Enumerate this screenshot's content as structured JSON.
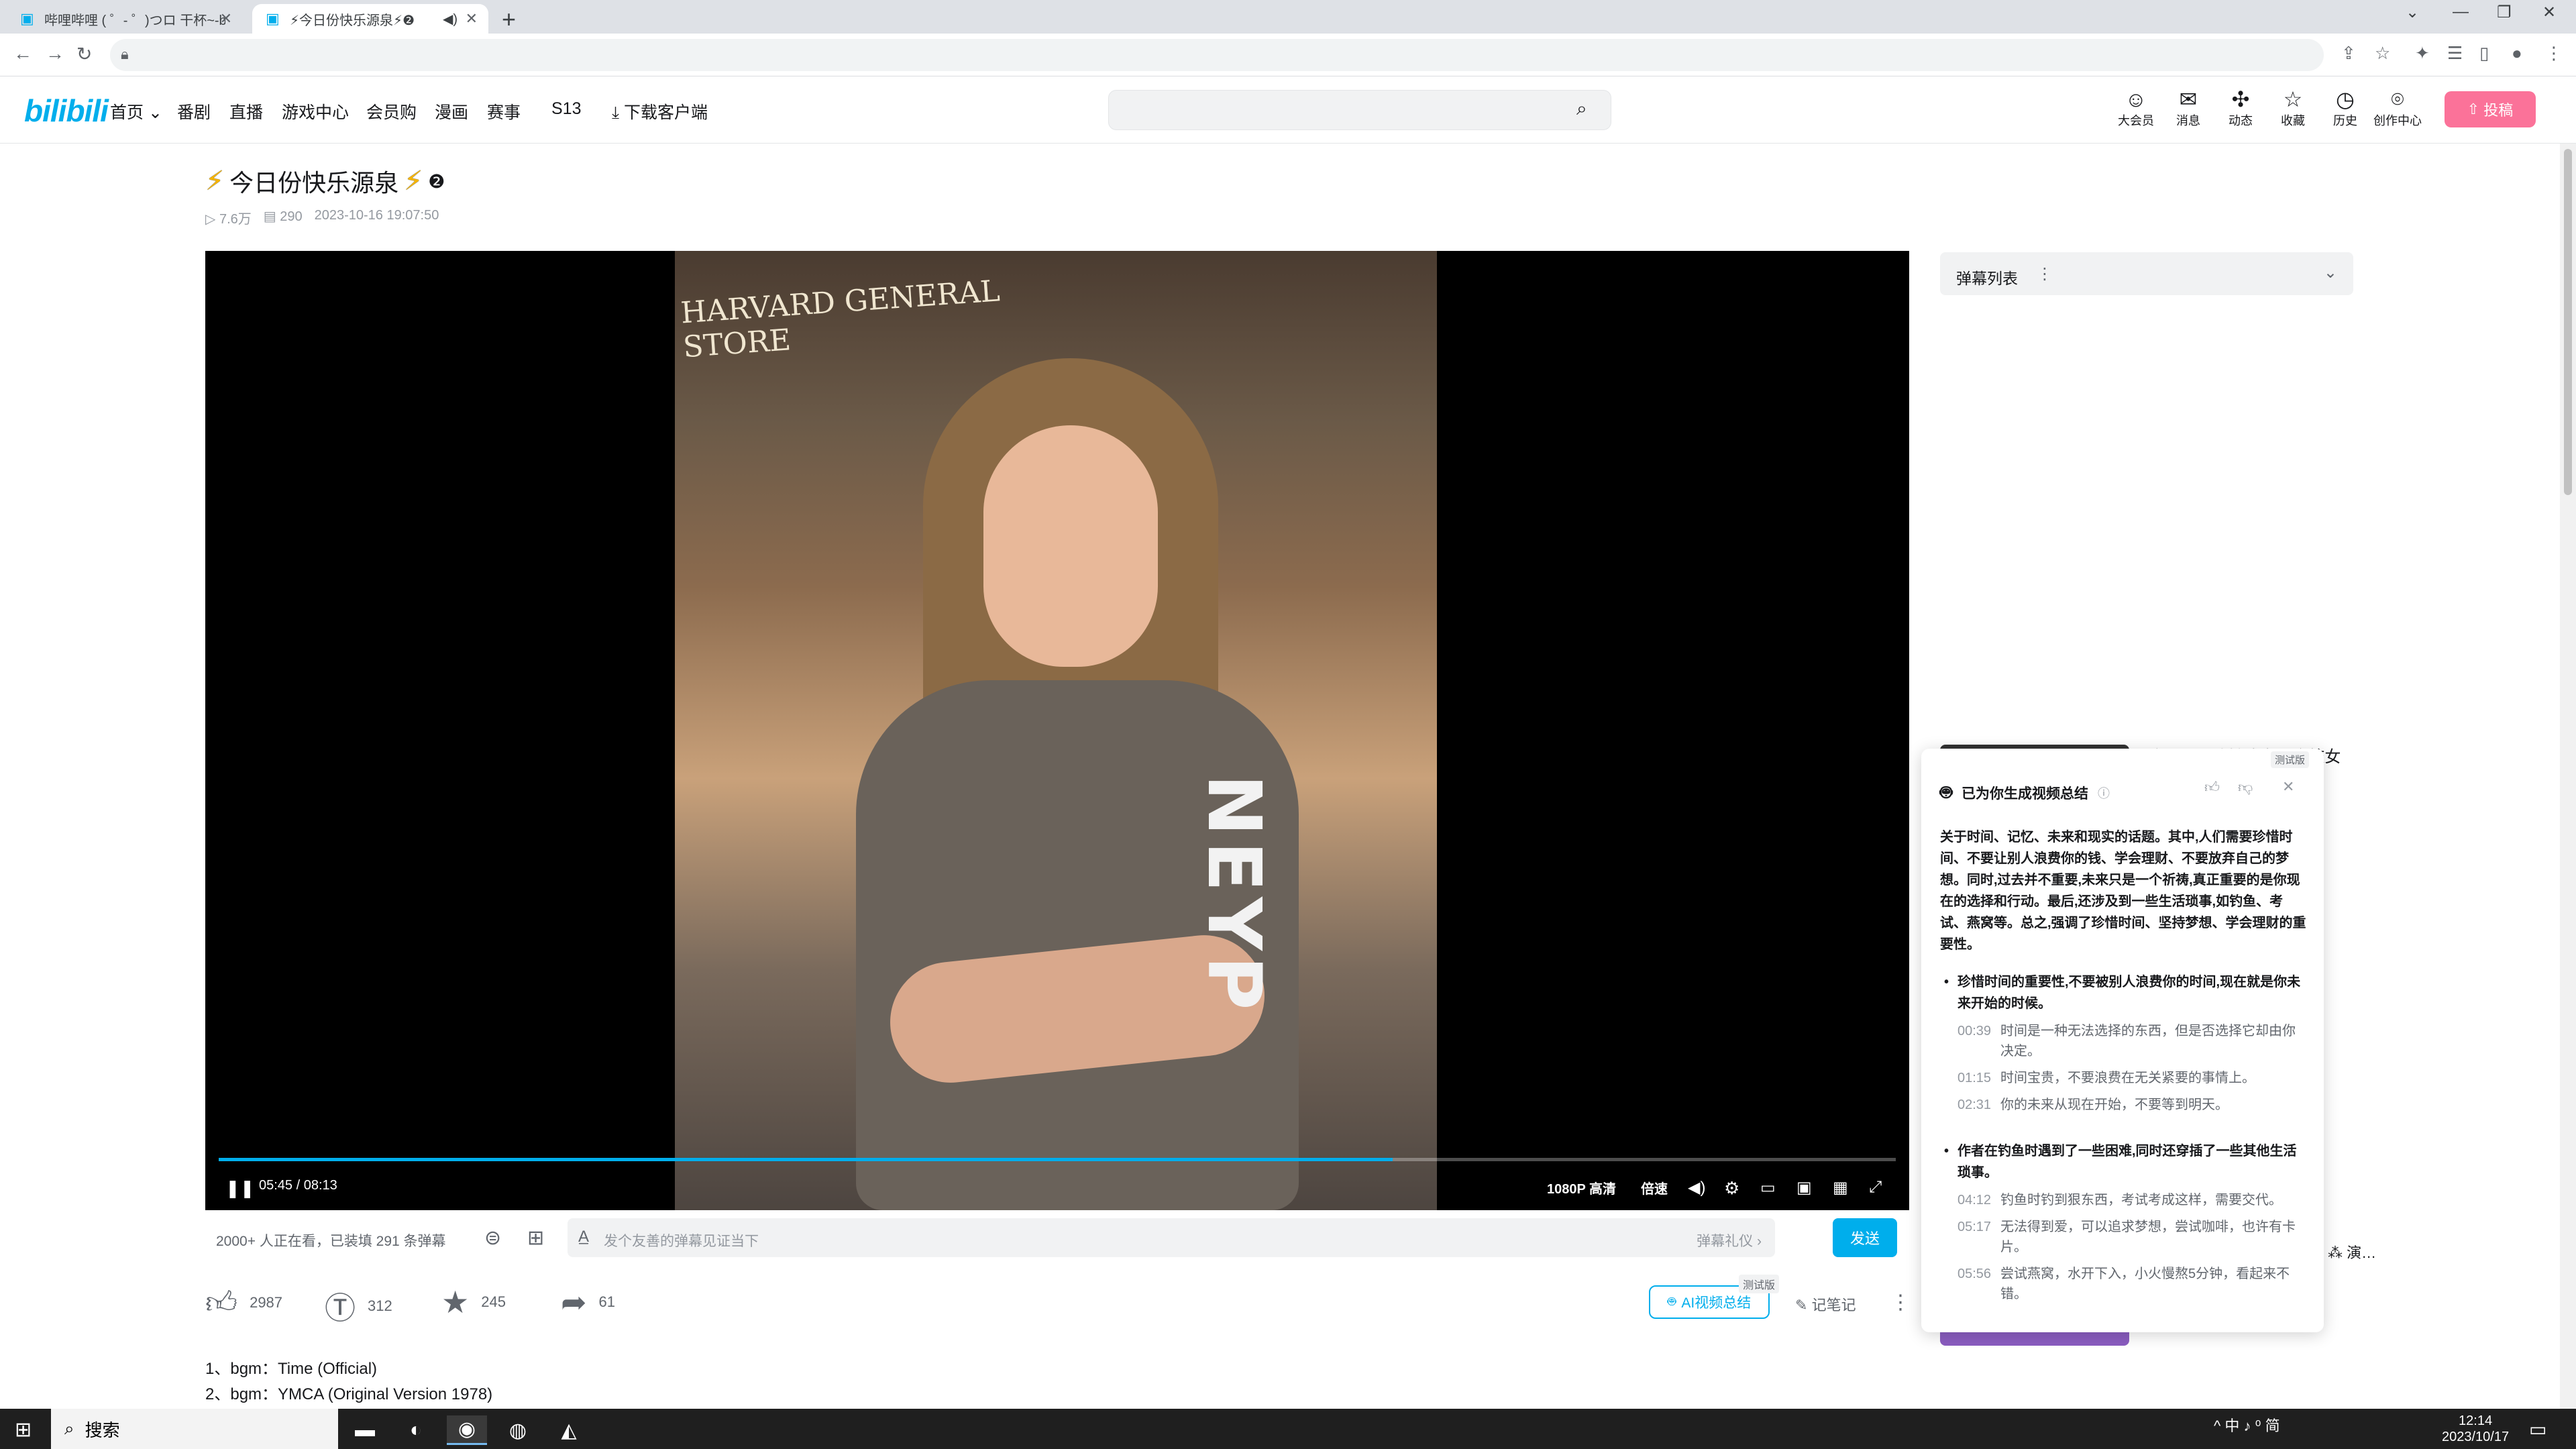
{
  "browser": {
    "tabs": [
      {
        "label": "哔哩哔哩 ( ゜- ゜)つロ 干杯~-bili",
        "active": false
      },
      {
        "label": "⚡今日份快乐源泉⚡❷",
        "active": true
      }
    ],
    "new_tab": "+"
  },
  "site": {
    "logo": "bilibili",
    "nav": [
      "首页",
      "番剧",
      "直播",
      "游戏中心",
      "会员购",
      "漫画",
      "赛事",
      "S13",
      "下载客户端"
    ],
    "header_icons": [
      {
        "icon": "vip-icon",
        "label": "大会员"
      },
      {
        "icon": "message-icon",
        "label": "消息"
      },
      {
        "icon": "dynamic-icon",
        "label": "动态"
      },
      {
        "icon": "favorite-icon",
        "label": "收藏"
      },
      {
        "icon": "history-icon",
        "label": "历史"
      },
      {
        "icon": "creation-icon",
        "label": "创作中心"
      }
    ],
    "upload_label": "投稿"
  },
  "video": {
    "title": "今日份快乐源泉",
    "title_badge": "❷",
    "views": "7.6万",
    "danmaku_count": "290",
    "date": "2023-10-16 19:07:50",
    "sign_text": "HARVARD GENERAL STORE",
    "shirt_text": "NEYP",
    "current_time": "05:45",
    "duration": "08:13",
    "progress": 0.7,
    "quality": "1080P 高清",
    "speed_label": "倍速"
  },
  "danmaku_bar": {
    "viewers": "2000+ 人正在看，已装填 291 条弹幕",
    "placeholder": "发个友善的弹幕见证当下",
    "etiquette": "弹幕礼仪 ›",
    "send": "发送"
  },
  "toolbar": {
    "like": "2987",
    "coin": "312",
    "favorite": "245",
    "share": "61",
    "ai_label": "AI视频总结",
    "beta": "测试版",
    "notes": "记笔记"
  },
  "description": [
    "1、bgm：Time (Official)",
    "2、bgm：YMCA (Original Version 1978)"
  ],
  "sidebar": {
    "danmaku_list": "弹幕列表",
    "rec_title": "#这一题，让她成为了全校女",
    "rec_side": "⁂ 演…"
  },
  "ai_panel": {
    "beta": "测试版",
    "heading": "已为你生成视频总结",
    "summary": "关于时间、记忆、未来和现实的话题。其中,人们需要珍惜时间、不要让别人浪费你的钱、学会理财、不要放弃自己的梦想。同时,过去并不重要,未来只是一个祈祷,真正重要的是你现在的选择和行动。最后,还涉及到一些生活琐事,如钓鱼、考试、燕窝等。总之,强调了珍惜时间、坚持梦想、学会理财的重要性。",
    "sections": [
      {
        "bullet": "珍惜时间的重要性,不要被别人浪费你的时间,现在就是你未来开始的时候。",
        "points": [
          {
            "ts": "00:39",
            "text": "时间是一种无法选择的东西，但是否选择它却由你决定。"
          },
          {
            "ts": "01:15",
            "text": "时间宝贵，不要浪费在无关紧要的事情上。"
          },
          {
            "ts": "02:31",
            "text": "你的未来从现在开始，不要等到明天。"
          }
        ]
      },
      {
        "bullet": "作者在钓鱼时遇到了一些困难,同时还穿插了一些其他生活琐事。",
        "points": [
          {
            "ts": "04:12",
            "text": "钓鱼时钓到狠东西，考试考成这样，需要交代。"
          },
          {
            "ts": "05:17",
            "text": "无法得到爱，可以追求梦想，尝试咖啡，也许有卡片。"
          },
          {
            "ts": "05:56",
            "text": "尝试燕窝，水开下入，小火慢熬5分钟，看起来不错。"
          }
        ]
      }
    ]
  },
  "taskbar": {
    "search": "搜索",
    "tray": "^ 中 ♪ ⁰ 简",
    "time": "12:14",
    "date": "2023/10/17"
  }
}
